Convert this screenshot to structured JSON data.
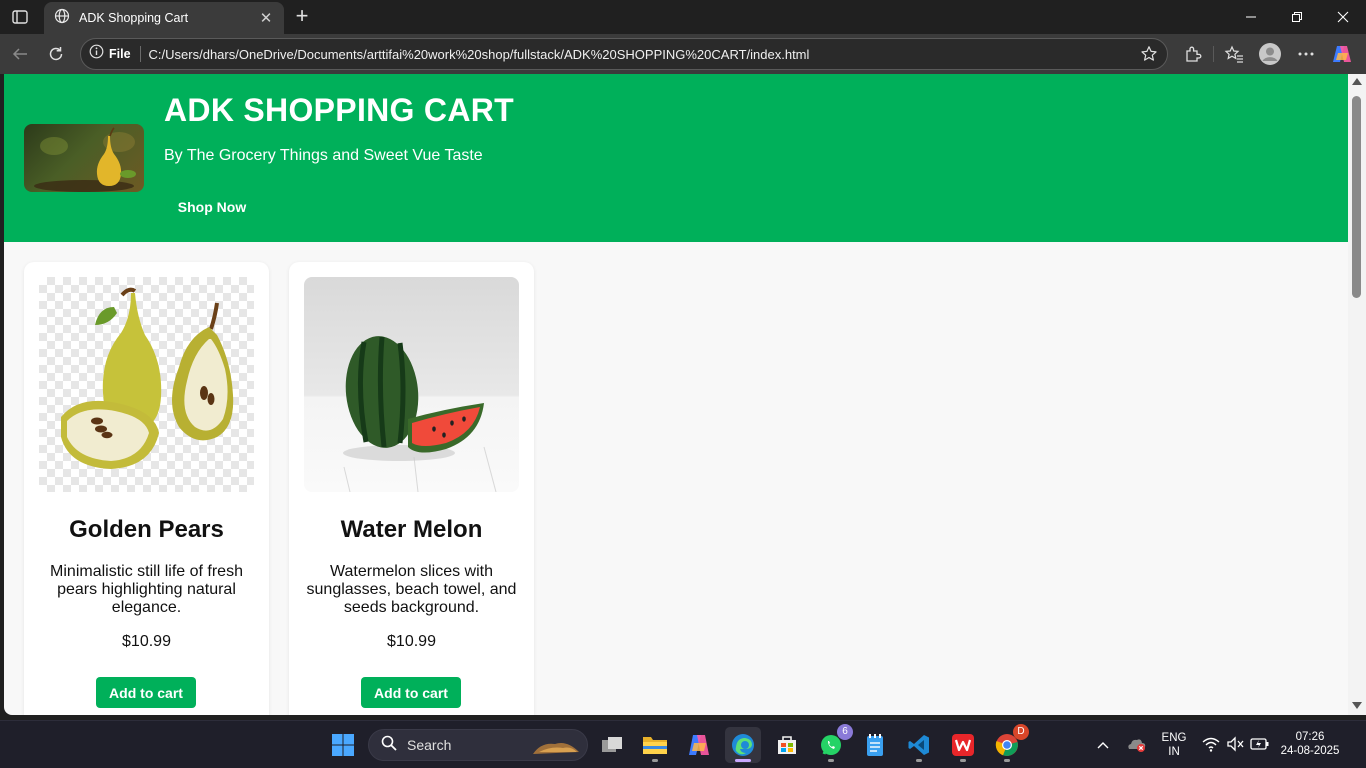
{
  "browser": {
    "tab_title": "ADK Shopping Cart",
    "file_label": "File",
    "url": "C:/Users/dhars/OneDrive/Documents/arttifai%20work%20shop/fullstack/ADK%20SHOPPING%20CART/index.html"
  },
  "hero": {
    "title": "ADK SHOPPING CART",
    "subtitle": "By The Grocery Things and Sweet Vue Taste",
    "cta_label": "Shop Now"
  },
  "products": [
    {
      "name": "Golden Pears",
      "description": "Minimalistic still life of fresh pears highlighting natural elegance.",
      "price": "$10.99",
      "button_label": "Add to cart"
    },
    {
      "name": "Water Melon",
      "description": "Watermelon slices with sunglasses, beach towel, and seeds background.",
      "price": "$10.99",
      "button_label": "Add to cart"
    }
  ],
  "taskbar": {
    "search_placeholder": "Search",
    "whatsapp_badge": "6",
    "chrome_badge": "D",
    "language_line1": "ENG",
    "language_line2": "IN",
    "time": "07:26",
    "date": "24-08-2025"
  },
  "colors": {
    "brand_green": "#00b05a",
    "page_background": "#f8f8f8"
  }
}
